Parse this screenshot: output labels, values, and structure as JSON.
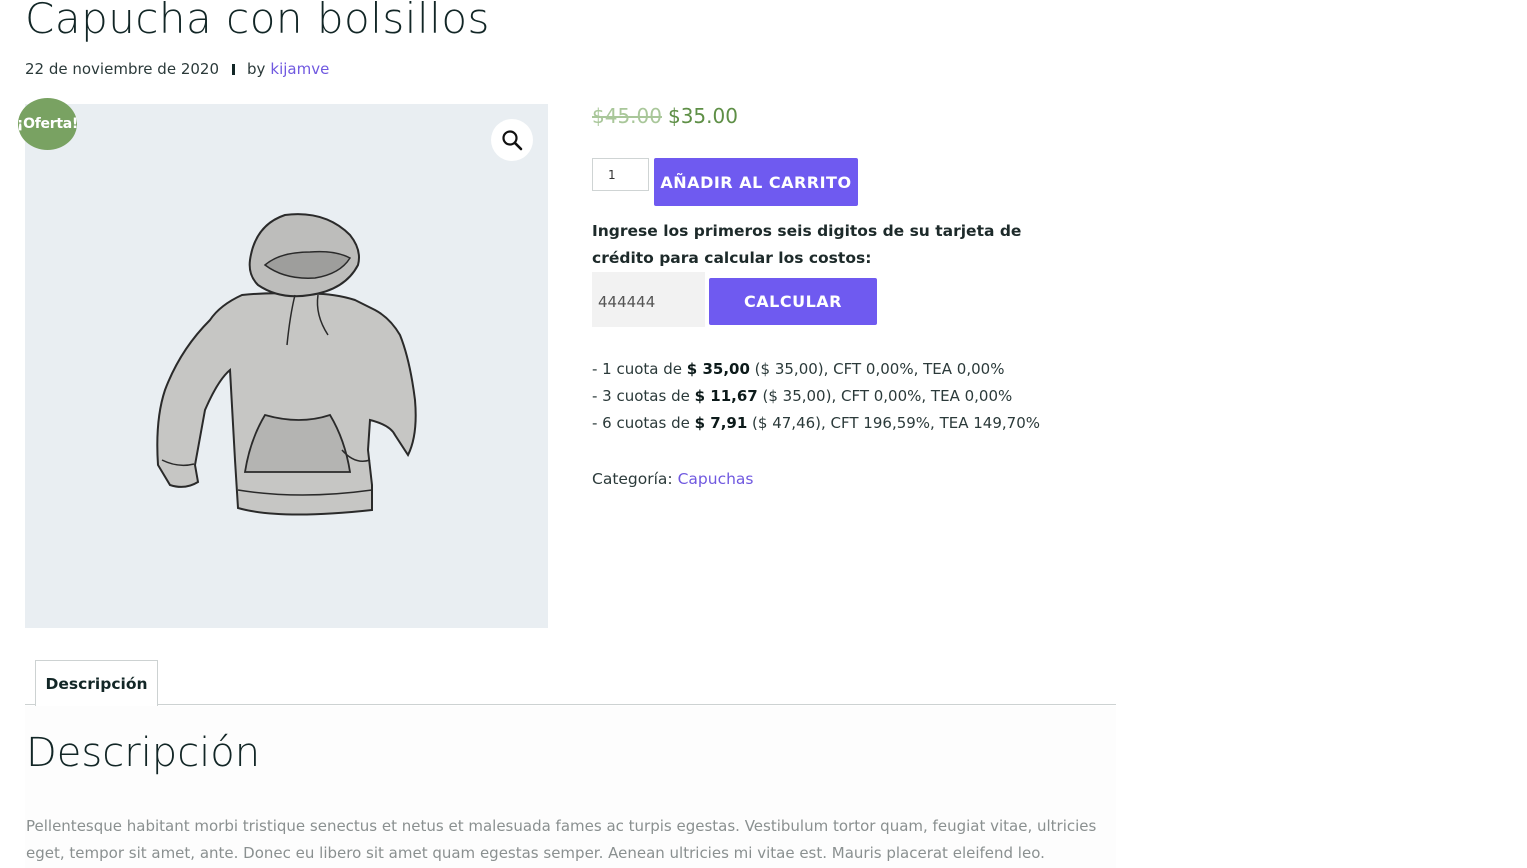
{
  "product": {
    "title": "Capucha con bolsillos",
    "date": "22 de noviembre de 2020",
    "by_label": "by",
    "author": "kijamve",
    "sale_badge": "¡Oferta!",
    "old_price": "$45.00",
    "new_price": "$35.00",
    "quantity": "1",
    "add_to_cart_label": "AÑADIR AL CARRITO"
  },
  "calculator": {
    "prompt": "Ingrese los primeros seis digitos de su tarjeta de crédito para calcular los costos:",
    "card_value": "444444",
    "button_label": "CALCULAR",
    "installments": [
      {
        "prefix": "- 1 cuota de ",
        "amount": "$ 35,00",
        "suffix": " ($ 35,00), CFT 0,00%, TEA 0,00%"
      },
      {
        "prefix": "- 3 cuotas de ",
        "amount": "$ 11,67",
        "suffix": " ($ 35,00), CFT 0,00%, TEA 0,00%"
      },
      {
        "prefix": "- 6 cuotas de ",
        "amount": "$ 7,91",
        "suffix": " ($ 47,46), CFT 196,59%, TEA 149,70%"
      }
    ]
  },
  "category": {
    "label": "Categoría:",
    "value": "Capuchas"
  },
  "tabs": {
    "description_tab": "Descripción",
    "heading": "Descripción",
    "text": "Pellentesque habitant morbi tristique senectus et netus et malesuada fames ac turpis egestas. Vestibulum tortor quam, feugiat vitae, ultricies eget, tempor sit amet, ante. Donec eu libero sit amet quam egestas semper. Aenean ultricies mi vitae est. Mauris placerat eleifend leo."
  },
  "icons": {
    "zoom": "magnifier-icon",
    "product_image": "hoodie-image"
  },
  "colors": {
    "accent": "#6f5af0",
    "link": "#7059e0",
    "sale_badge": "#79a262",
    "new_price": "#5e8f46",
    "old_price": "#a9c79a",
    "gallery_bg": "#e9eef2"
  }
}
